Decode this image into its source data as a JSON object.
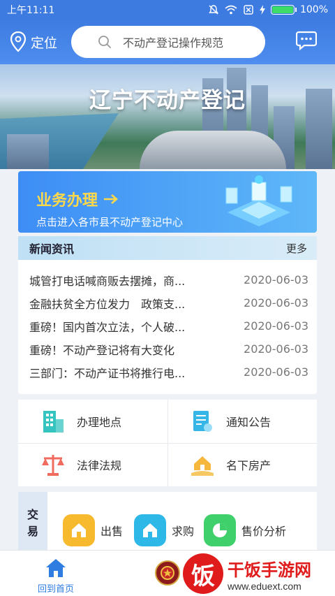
{
  "status": {
    "time": "上午11:11",
    "battery": "100%",
    "battery_level": 1.0
  },
  "header": {
    "location_label": "定位",
    "search_placeholder": "不动产登记操作规范"
  },
  "banner": {
    "title": "辽宁不动产登记"
  },
  "business": {
    "title": "业务办理",
    "subtitle": "点击进入各市县不动产登记中心"
  },
  "news": {
    "heading": "新闻资讯",
    "more": "更多",
    "items": [
      {
        "title": "城管打电话喊商贩去摆摊，商...",
        "date": "2020-06-03"
      },
      {
        "title": "金融扶贫全方位发力　政策支...",
        "date": "2020-06-03"
      },
      {
        "title": "重磅！国内首次立法，个人破...",
        "date": "2020-06-03"
      },
      {
        "title": "重磅！不动产登记将有大变化",
        "date": "2020-06-03"
      },
      {
        "title": "三部门：不动产证书将推行电...",
        "date": "2020-06-03"
      }
    ]
  },
  "services": [
    {
      "label": "办理地点",
      "icon": "building-icon",
      "color": "#35c4c0"
    },
    {
      "label": "通知公告",
      "icon": "notice-icon",
      "color": "#35b6e6"
    },
    {
      "label": "法律法规",
      "icon": "scales-icon",
      "color": "#f06a5e"
    },
    {
      "label": "名下房产",
      "icon": "house-hand-icon",
      "color": "#f5b83d"
    }
  ],
  "trade": {
    "side_label_1": "交",
    "side_label_2": "易",
    "items": [
      {
        "label": "出售",
        "icon": "house-icon",
        "color": "#f7b92e"
      },
      {
        "label": "求购",
        "icon": "house-icon",
        "color": "#2db8e8"
      },
      {
        "label": "售价分析",
        "icon": "pie-chart-icon",
        "color": "#3fcf6b"
      }
    ]
  },
  "tabbar": {
    "home_label": "回到首页"
  },
  "watermark": {
    "brand_char": "饭",
    "name": "干饭手游网",
    "url": "www.eduext.com"
  }
}
